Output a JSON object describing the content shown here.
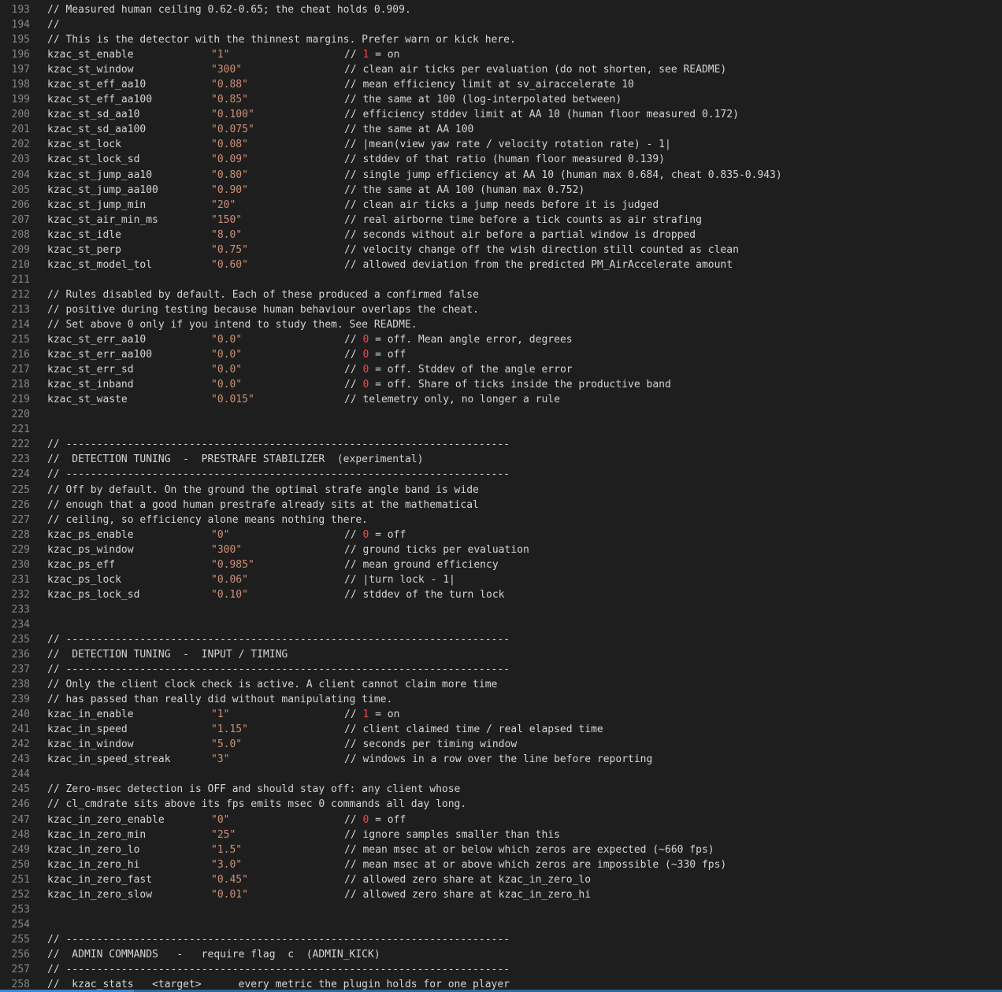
{
  "lines": [
    {
      "n": "193",
      "kind": "comment",
      "text": "// Measured human ceiling 0.62-0.65; the cheat holds 0.909."
    },
    {
      "n": "194",
      "kind": "comment",
      "text": "//"
    },
    {
      "n": "195",
      "kind": "comment",
      "text": "// This is the detector with the thinnest margins. Prefer warn or kick here."
    },
    {
      "n": "196",
      "kind": "cvar",
      "name": "kzac_st_enable",
      "value": "\"1\"",
      "c_pre": "// ",
      "c_num": "1",
      "c_post": " = on"
    },
    {
      "n": "197",
      "kind": "cvar",
      "name": "kzac_st_window",
      "value": "\"300\"",
      "comment": "// clean air ticks per evaluation (do not shorten, see README)"
    },
    {
      "n": "198",
      "kind": "cvar",
      "name": "kzac_st_eff_aa10",
      "value": "\"0.88\"",
      "comment": "// mean efficiency limit at sv_airaccelerate 10"
    },
    {
      "n": "199",
      "kind": "cvar",
      "name": "kzac_st_eff_aa100",
      "value": "\"0.85\"",
      "comment": "// the same at 100 (log-interpolated between)"
    },
    {
      "n": "200",
      "kind": "cvar",
      "name": "kzac_st_sd_aa10",
      "value": "\"0.100\"",
      "comment": "// efficiency stddev limit at AA 10 (human floor measured 0.172)"
    },
    {
      "n": "201",
      "kind": "cvar",
      "name": "kzac_st_sd_aa100",
      "value": "\"0.075\"",
      "comment": "// the same at AA 100"
    },
    {
      "n": "202",
      "kind": "cvar",
      "name": "kzac_st_lock",
      "value": "\"0.08\"",
      "comment": "// |mean(view yaw rate / velocity rotation rate) - 1|"
    },
    {
      "n": "203",
      "kind": "cvar",
      "name": "kzac_st_lock_sd",
      "value": "\"0.09\"",
      "comment": "// stddev of that ratio (human floor measured 0.139)"
    },
    {
      "n": "204",
      "kind": "cvar",
      "name": "kzac_st_jump_aa10",
      "value": "\"0.80\"",
      "comment": "// single jump efficiency at AA 10 (human max 0.684, cheat 0.835-0.943)"
    },
    {
      "n": "205",
      "kind": "cvar",
      "name": "kzac_st_jump_aa100",
      "value": "\"0.90\"",
      "comment": "// the same at AA 100 (human max 0.752)"
    },
    {
      "n": "206",
      "kind": "cvar",
      "name": "kzac_st_jump_min",
      "value": "\"20\"",
      "comment": "// clean air ticks a jump needs before it is judged"
    },
    {
      "n": "207",
      "kind": "cvar",
      "name": "kzac_st_air_min_ms",
      "value": "\"150\"",
      "comment": "// real airborne time before a tick counts as air strafing"
    },
    {
      "n": "208",
      "kind": "cvar",
      "name": "kzac_st_idle",
      "value": "\"8.0\"",
      "comment": "// seconds without air before a partial window is dropped"
    },
    {
      "n": "209",
      "kind": "cvar",
      "name": "kzac_st_perp",
      "value": "\"0.75\"",
      "comment": "// velocity change off the wish direction still counted as clean"
    },
    {
      "n": "210",
      "kind": "cvar",
      "name": "kzac_st_model_tol",
      "value": "\"0.60\"",
      "comment": "// allowed deviation from the predicted PM_AirAccelerate amount"
    },
    {
      "n": "211",
      "kind": "blank"
    },
    {
      "n": "212",
      "kind": "comment",
      "text": "// Rules disabled by default. Each of these produced a confirmed false"
    },
    {
      "n": "213",
      "kind": "comment",
      "text": "// positive during testing because human behaviour overlaps the cheat."
    },
    {
      "n": "214",
      "kind": "comment",
      "text": "// Set above 0 only if you intend to study them. See README."
    },
    {
      "n": "215",
      "kind": "cvar",
      "name": "kzac_st_err_aa10",
      "value": "\"0.0\"",
      "c_pre": "// ",
      "c_num": "0",
      "c_post": " = off. Mean angle error, degrees"
    },
    {
      "n": "216",
      "kind": "cvar",
      "name": "kzac_st_err_aa100",
      "value": "\"0.0\"",
      "c_pre": "// ",
      "c_num": "0",
      "c_post": " = off"
    },
    {
      "n": "217",
      "kind": "cvar",
      "name": "kzac_st_err_sd",
      "value": "\"0.0\"",
      "c_pre": "// ",
      "c_num": "0",
      "c_post": " = off. Stddev of the angle error"
    },
    {
      "n": "218",
      "kind": "cvar",
      "name": "kzac_st_inband",
      "value": "\"0.0\"",
      "c_pre": "// ",
      "c_num": "0",
      "c_post": " = off. Share of ticks inside the productive band"
    },
    {
      "n": "219",
      "kind": "cvar",
      "name": "kzac_st_waste",
      "value": "\"0.015\"",
      "comment": "// telemetry only, no longer a rule"
    },
    {
      "n": "220",
      "kind": "blank"
    },
    {
      "n": "221",
      "kind": "blank"
    },
    {
      "n": "222",
      "kind": "comment",
      "text": "// ------------------------------------------------------------------------"
    },
    {
      "n": "223",
      "kind": "comment",
      "text": "//  DETECTION TUNING  -  PRESTRAFE STABILIZER  (experimental)"
    },
    {
      "n": "224",
      "kind": "comment",
      "text": "// ------------------------------------------------------------------------"
    },
    {
      "n": "225",
      "kind": "comment",
      "text": "// Off by default. On the ground the optimal strafe angle band is wide"
    },
    {
      "n": "226",
      "kind": "comment",
      "text": "// enough that a good human prestrafe already sits at the mathematical"
    },
    {
      "n": "227",
      "kind": "comment",
      "text": "// ceiling, so efficiency alone means nothing there."
    },
    {
      "n": "228",
      "kind": "cvar",
      "name": "kzac_ps_enable",
      "value": "\"0\"",
      "c_pre": "// ",
      "c_num": "0",
      "c_post": " = off"
    },
    {
      "n": "229",
      "kind": "cvar",
      "name": "kzac_ps_window",
      "value": "\"300\"",
      "comment": "// ground ticks per evaluation"
    },
    {
      "n": "230",
      "kind": "cvar",
      "name": "kzac_ps_eff",
      "value": "\"0.985\"",
      "comment": "// mean ground efficiency"
    },
    {
      "n": "231",
      "kind": "cvar",
      "name": "kzac_ps_lock",
      "value": "\"0.06\"",
      "comment": "// |turn lock - 1|"
    },
    {
      "n": "232",
      "kind": "cvar",
      "name": "kzac_ps_lock_sd",
      "value": "\"0.10\"",
      "comment": "// stddev of the turn lock"
    },
    {
      "n": "233",
      "kind": "blank"
    },
    {
      "n": "234",
      "kind": "blank"
    },
    {
      "n": "235",
      "kind": "comment",
      "text": "// ------------------------------------------------------------------------"
    },
    {
      "n": "236",
      "kind": "comment",
      "text": "//  DETECTION TUNING  -  INPUT / TIMING"
    },
    {
      "n": "237",
      "kind": "comment",
      "text": "// ------------------------------------------------------------------------"
    },
    {
      "n": "238",
      "kind": "comment",
      "text": "// Only the client clock check is active. A client cannot claim more time"
    },
    {
      "n": "239",
      "kind": "comment",
      "text": "// has passed than really did without manipulating time."
    },
    {
      "n": "240",
      "kind": "cvar",
      "name": "kzac_in_enable",
      "value": "\"1\"",
      "c_pre": "// ",
      "c_num": "1",
      "c_post": " = on"
    },
    {
      "n": "241",
      "kind": "cvar",
      "name": "kzac_in_speed",
      "value": "\"1.15\"",
      "comment": "// client claimed time / real elapsed time"
    },
    {
      "n": "242",
      "kind": "cvar",
      "name": "kzac_in_window",
      "value": "\"5.0\"",
      "comment": "// seconds per timing window"
    },
    {
      "n": "243",
      "kind": "cvar",
      "name": "kzac_in_speed_streak",
      "value": "\"3\"",
      "comment": "// windows in a row over the line before reporting"
    },
    {
      "n": "244",
      "kind": "blank"
    },
    {
      "n": "245",
      "kind": "comment",
      "text": "// Zero-msec detection is OFF and should stay off: any client whose"
    },
    {
      "n": "246",
      "kind": "comment",
      "text": "// cl_cmdrate sits above its fps emits msec 0 commands all day long."
    },
    {
      "n": "247",
      "kind": "cvar",
      "name": "kzac_in_zero_enable",
      "value": "\"0\"",
      "c_pre": "// ",
      "c_num": "0",
      "c_post": " = off"
    },
    {
      "n": "248",
      "kind": "cvar",
      "name": "kzac_in_zero_min",
      "value": "\"25\"",
      "comment": "// ignore samples smaller than this"
    },
    {
      "n": "249",
      "kind": "cvar",
      "name": "kzac_in_zero_lo",
      "value": "\"1.5\"",
      "comment": "// mean msec at or below which zeros are expected (~660 fps)"
    },
    {
      "n": "250",
      "kind": "cvar",
      "name": "kzac_in_zero_hi",
      "value": "\"3.0\"",
      "comment": "// mean msec at or above which zeros are impossible (~330 fps)"
    },
    {
      "n": "251",
      "kind": "cvar",
      "name": "kzac_in_zero_fast",
      "value": "\"0.45\"",
      "comment": "// allowed zero share at kzac_in_zero_lo"
    },
    {
      "n": "252",
      "kind": "cvar",
      "name": "kzac_in_zero_slow",
      "value": "\"0.01\"",
      "comment": "// allowed zero share at kzac_in_zero_hi"
    },
    {
      "n": "253",
      "kind": "blank"
    },
    {
      "n": "254",
      "kind": "blank"
    },
    {
      "n": "255",
      "kind": "comment",
      "text": "// ------------------------------------------------------------------------"
    },
    {
      "n": "256",
      "kind": "comment",
      "text": "//  ADMIN COMMANDS   -   require flag  c  (ADMIN_KICK)"
    },
    {
      "n": "257",
      "kind": "comment",
      "text": "// ------------------------------------------------------------------------"
    },
    {
      "n": "258",
      "kind": "comment",
      "text": "//  kzac_stats   <target>      every metric the plugin holds for one player"
    }
  ]
}
